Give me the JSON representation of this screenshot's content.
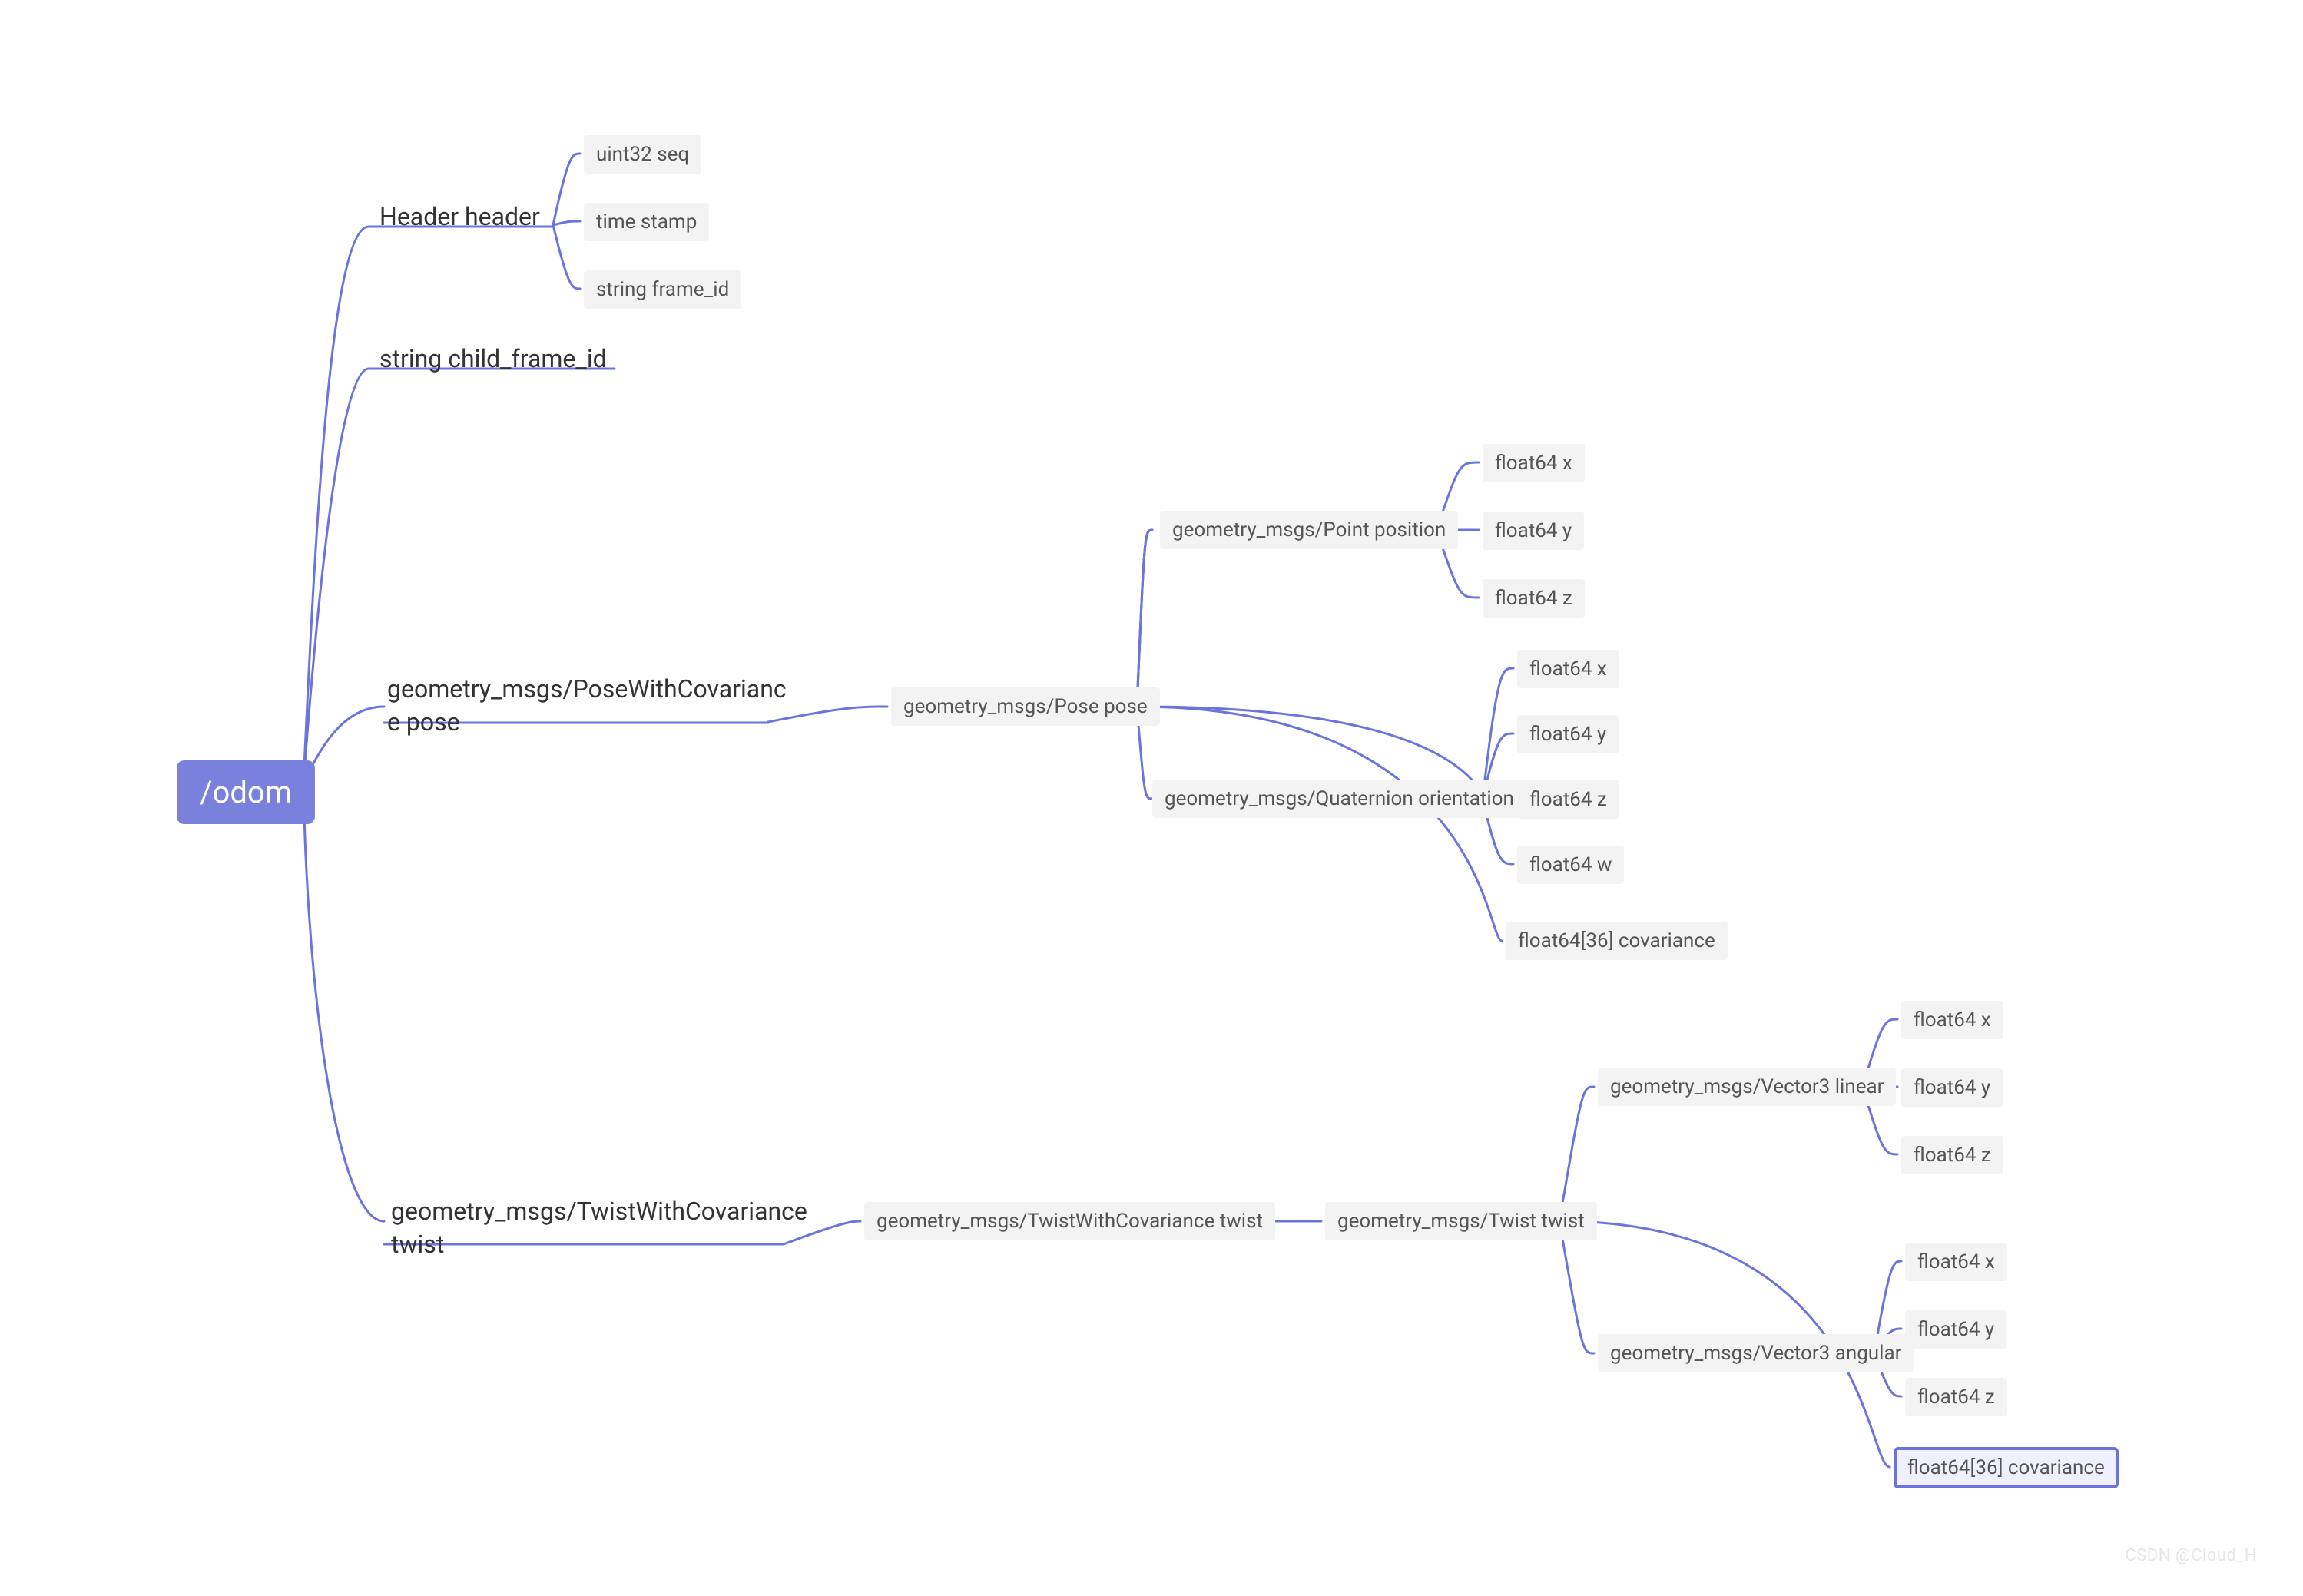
{
  "chart_data": {
    "type": "tree",
    "root": "/odom",
    "children": [
      {
        "label": "Header header",
        "children": [
          {
            "label": "uint32 seq"
          },
          {
            "label": "time stamp"
          },
          {
            "label": "string frame_id"
          }
        ]
      },
      {
        "label": "string child_frame_id"
      },
      {
        "label": "geometry_msgs/PoseWithCovariance pose",
        "children": [
          {
            "label": "geometry_msgs/Pose pose",
            "children": [
              {
                "label": "geometry_msgs/Point position",
                "children": [
                  {
                    "label": "float64 x"
                  },
                  {
                    "label": "float64 y"
                  },
                  {
                    "label": "float64 z"
                  }
                ]
              },
              {
                "label": "geometry_msgs/Quaternion orientation",
                "children": [
                  {
                    "label": "float64 x"
                  },
                  {
                    "label": "float64 y"
                  },
                  {
                    "label": "float64 z"
                  },
                  {
                    "label": "float64 w"
                  }
                ]
              },
              {
                "label": "float64[36] covariance"
              }
            ]
          }
        ]
      },
      {
        "label": "geometry_msgs/TwistWithCovariance twist",
        "children": [
          {
            "label": "geometry_msgs/TwistWithCovariance twist",
            "children": [
              {
                "label": "geometry_msgs/Twist twist",
                "children": [
                  {
                    "label": "geometry_msgs/Vector3 linear",
                    "children": [
                      {
                        "label": "float64 x"
                      },
                      {
                        "label": "float64 y"
                      },
                      {
                        "label": "float64 z"
                      }
                    ]
                  },
                  {
                    "label": "geometry_msgs/Vector3 angular",
                    "children": [
                      {
                        "label": "float64 x"
                      },
                      {
                        "label": "float64 y"
                      },
                      {
                        "label": "float64 z"
                      }
                    ]
                  },
                  {
                    "label": "float64[36] covariance",
                    "selected": true
                  }
                ]
              }
            ]
          }
        ]
      }
    ]
  },
  "root_label": "/odom",
  "b0_label": "Header header",
  "b0_c0": "uint32 seq",
  "b0_c1": "time stamp",
  "b0_c2": "string frame_id",
  "b1_label": "string child_frame_id",
  "b2_label_l1": "geometry_msgs/PoseWithCovarianc",
  "b2_label_l2": "e pose",
  "b2_pose": "geometry_msgs/Pose pose",
  "b2_point": "geometry_msgs/Point position",
  "b2_point_x": "float64 x",
  "b2_point_y": "float64 y",
  "b2_point_z": "float64 z",
  "b2_quat": "geometry_msgs/Quaternion orientation",
  "b2_quat_x": "float64 x",
  "b2_quat_y": "float64 y",
  "b2_quat_z": "float64 z",
  "b2_quat_w": "float64 w",
  "b2_cov": "float64[36] covariance",
  "b3_label_l1": "geometry_msgs/TwistWithCovariance",
  "b3_label_l2": "twist",
  "b3_twist1": "geometry_msgs/TwistWithCovariance twist",
  "b3_twist2": "geometry_msgs/Twist twist",
  "b3_lin": "geometry_msgs/Vector3 linear",
  "b3_lin_x": "float64 x",
  "b3_lin_y": "float64 y",
  "b3_lin_z": "float64 z",
  "b3_ang": "geometry_msgs/Vector3 angular",
  "b3_ang_x": "float64 x",
  "b3_ang_y": "float64 y",
  "b3_ang_z": "float64 z",
  "b3_cov": "float64[36] covariance",
  "watermark": "CSDN @Cloud_H"
}
